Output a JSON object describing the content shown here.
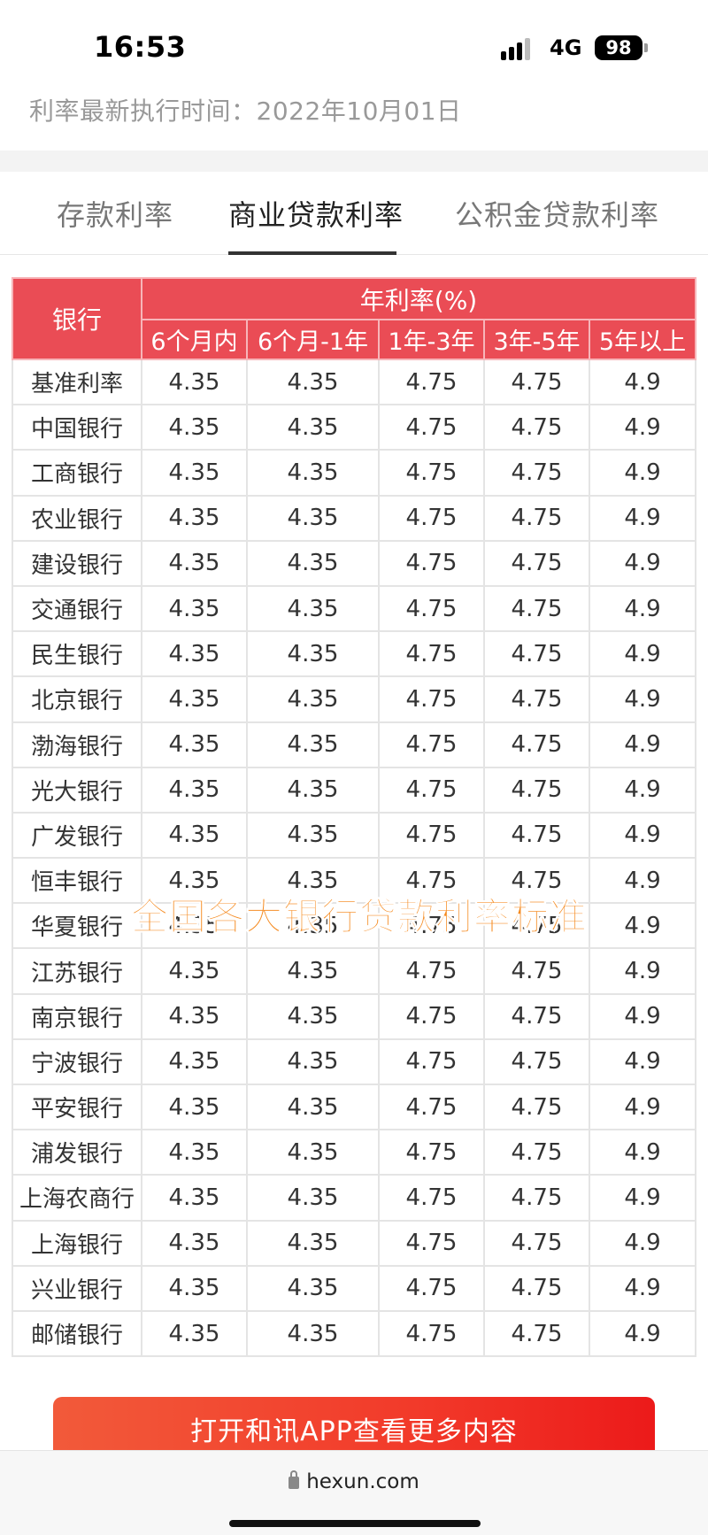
{
  "status_bar": {
    "time": "16:53",
    "network": "4G",
    "battery": "98"
  },
  "exec_time": "利率最新执行时间：2022年10月01日",
  "tabs": [
    {
      "label": "存款利率",
      "active": false
    },
    {
      "label": "商业贷款利率",
      "active": true
    },
    {
      "label": "公积金贷款利率",
      "active": false
    }
  ],
  "table": {
    "bank_header": "银行",
    "group_header": "年利率(%)",
    "columns": [
      "6个月内",
      "6个月-1年",
      "1年-3年",
      "3年-5年",
      "5年以上"
    ],
    "rows": [
      {
        "bank": "基准利率",
        "values": [
          "4.35",
          "4.35",
          "4.75",
          "4.75",
          "4.9"
        ]
      },
      {
        "bank": "中国银行",
        "values": [
          "4.35",
          "4.35",
          "4.75",
          "4.75",
          "4.9"
        ]
      },
      {
        "bank": "工商银行",
        "values": [
          "4.35",
          "4.35",
          "4.75",
          "4.75",
          "4.9"
        ]
      },
      {
        "bank": "农业银行",
        "values": [
          "4.35",
          "4.35",
          "4.75",
          "4.75",
          "4.9"
        ]
      },
      {
        "bank": "建设银行",
        "values": [
          "4.35",
          "4.35",
          "4.75",
          "4.75",
          "4.9"
        ]
      },
      {
        "bank": "交通银行",
        "values": [
          "4.35",
          "4.35",
          "4.75",
          "4.75",
          "4.9"
        ]
      },
      {
        "bank": "民生银行",
        "values": [
          "4.35",
          "4.35",
          "4.75",
          "4.75",
          "4.9"
        ]
      },
      {
        "bank": "北京银行",
        "values": [
          "4.35",
          "4.35",
          "4.75",
          "4.75",
          "4.9"
        ]
      },
      {
        "bank": "渤海银行",
        "values": [
          "4.35",
          "4.35",
          "4.75",
          "4.75",
          "4.9"
        ]
      },
      {
        "bank": "光大银行",
        "values": [
          "4.35",
          "4.35",
          "4.75",
          "4.75",
          "4.9"
        ]
      },
      {
        "bank": "广发银行",
        "values": [
          "4.35",
          "4.35",
          "4.75",
          "4.75",
          "4.9"
        ]
      },
      {
        "bank": "恒丰银行",
        "values": [
          "4.35",
          "4.35",
          "4.75",
          "4.75",
          "4.9"
        ]
      },
      {
        "bank": "华夏银行",
        "values": [
          "4.35",
          "4.35",
          "4.75",
          "4.75",
          "4.9"
        ]
      },
      {
        "bank": "江苏银行",
        "values": [
          "4.35",
          "4.35",
          "4.75",
          "4.75",
          "4.9"
        ]
      },
      {
        "bank": "南京银行",
        "values": [
          "4.35",
          "4.35",
          "4.75",
          "4.75",
          "4.9"
        ]
      },
      {
        "bank": "宁波银行",
        "values": [
          "4.35",
          "4.35",
          "4.75",
          "4.75",
          "4.9"
        ]
      },
      {
        "bank": "平安银行",
        "values": [
          "4.35",
          "4.35",
          "4.75",
          "4.75",
          "4.9"
        ]
      },
      {
        "bank": "浦发银行",
        "values": [
          "4.35",
          "4.35",
          "4.75",
          "4.75",
          "4.9"
        ]
      },
      {
        "bank": "上海农商行",
        "values": [
          "4.35",
          "4.35",
          "4.75",
          "4.75",
          "4.9"
        ]
      },
      {
        "bank": "上海银行",
        "values": [
          "4.35",
          "4.35",
          "4.75",
          "4.75",
          "4.9"
        ]
      },
      {
        "bank": "兴业银行",
        "values": [
          "4.35",
          "4.35",
          "4.75",
          "4.75",
          "4.9"
        ]
      },
      {
        "bank": "邮储银行",
        "values": [
          "4.35",
          "4.35",
          "4.75",
          "4.75",
          "4.9"
        ]
      }
    ]
  },
  "watermark": "全国各大银行贷款利率标准",
  "open_app_button": "打开和讯APP查看更多内容",
  "browser": {
    "url": "hexun.com"
  },
  "colors": {
    "header_red": "#ea4c55",
    "watermark_orange": "#f58a1f",
    "button_red": "#f23a2a"
  }
}
